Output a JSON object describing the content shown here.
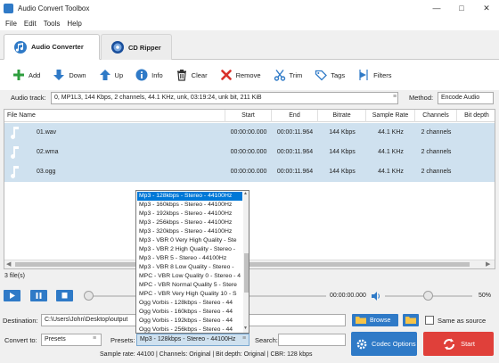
{
  "window": {
    "title": "Audio Convert Toolbox"
  },
  "menu": [
    "File",
    "Edit",
    "Tools",
    "Help"
  ],
  "tabs": [
    {
      "label": "Audio Converter",
      "icon": "audio-converter-icon"
    },
    {
      "label": "CD Ripper",
      "icon": "cd-icon"
    }
  ],
  "toolbar": {
    "add": "Add",
    "down": "Down",
    "up": "Up",
    "info": "Info",
    "clear": "Clear",
    "remove": "Remove",
    "trim": "Trim",
    "tags": "Tags",
    "filters": "Filters"
  },
  "track": {
    "label": "Audio track:",
    "value": "0, MP1L3, 144 Kbps, 2 channels, 44.1 KHz, unk, 03:19:24, unk bit, 211 KiB",
    "method_label": "Method:",
    "method_value": "Encode Audio"
  },
  "table": {
    "columns": [
      "File Name",
      "Start",
      "End",
      "Bitrate",
      "Sample Rate",
      "Channels",
      "Bit depth"
    ],
    "rows": [
      {
        "name": "01.wav",
        "start": "00:00:00.000",
        "end": "00:00:11.964",
        "bitrate": "144 Kbps",
        "sample_rate": "44.1 KHz",
        "channels": "2 channels"
      },
      {
        "name": "02.wma",
        "start": "00:00:00.000",
        "end": "00:00:11.964",
        "bitrate": "144 Kbps",
        "sample_rate": "44.1 KHz",
        "channels": "2 channels"
      },
      {
        "name": "03.ogg",
        "start": "00:00:00.000",
        "end": "00:00:11.964",
        "bitrate": "144 Kbps",
        "sample_rate": "44.1 KHz",
        "channels": "2 channels"
      }
    ],
    "file_count": "3 file(s)"
  },
  "preset_list": [
    "Mp3 - 128kbps - Stereo - 44100Hz",
    "Mp3 - 160kbps - Stereo - 44100Hz",
    "Mp3 - 192kbps - Stereo - 44100Hz",
    "Mp3 - 256kbps - Stereo - 44100Hz",
    "Mp3 - 320kbps - Stereo - 44100Hz",
    "Mp3 - VBR 0 Very High Quality - Ste",
    "Mp3 - VBR 2 High Quality - Stereo -",
    "Mp3 - VBR 5 - Stereo - 44100Hz",
    "Mp3 - VBR 8 Low Quality - Stereo -",
    "MPC - VBR Low Quality 0 - Stereo - 4",
    "MPC - VBR Normal Quality 5 - Stere",
    "MPC - VBR Very High Quality 10 - S",
    "Ogg Vorbis - 128kbps - Stereo - 44",
    "Ogg Vorbis - 160kbps - Stereo - 44",
    "Ogg Vorbis - 192kbps - Stereo - 44",
    "Ogg Vorbis - 256kbps - Stereo - 44"
  ],
  "player": {
    "time": "00:00:00.000",
    "volume": "50%",
    "volume_level": 0.5
  },
  "output": {
    "destination_label": "Destination:",
    "destination_value": "C:\\Users\\John\\Desktop\\output",
    "browse": "Browse",
    "same_as_source": "Same as source",
    "convert_to_label": "Convert to:",
    "convert_to_value": "Presets",
    "presets_label": "Presets:",
    "presets_value": "Mp3 - 128kbps - Stereo - 44100Hz",
    "search_label": "Search:",
    "codec_options": "Codec Options",
    "start": "Start",
    "status": "Sample rate: 44100 | Channels: Original | Bit depth: Original | CBR: 128 kbps"
  }
}
